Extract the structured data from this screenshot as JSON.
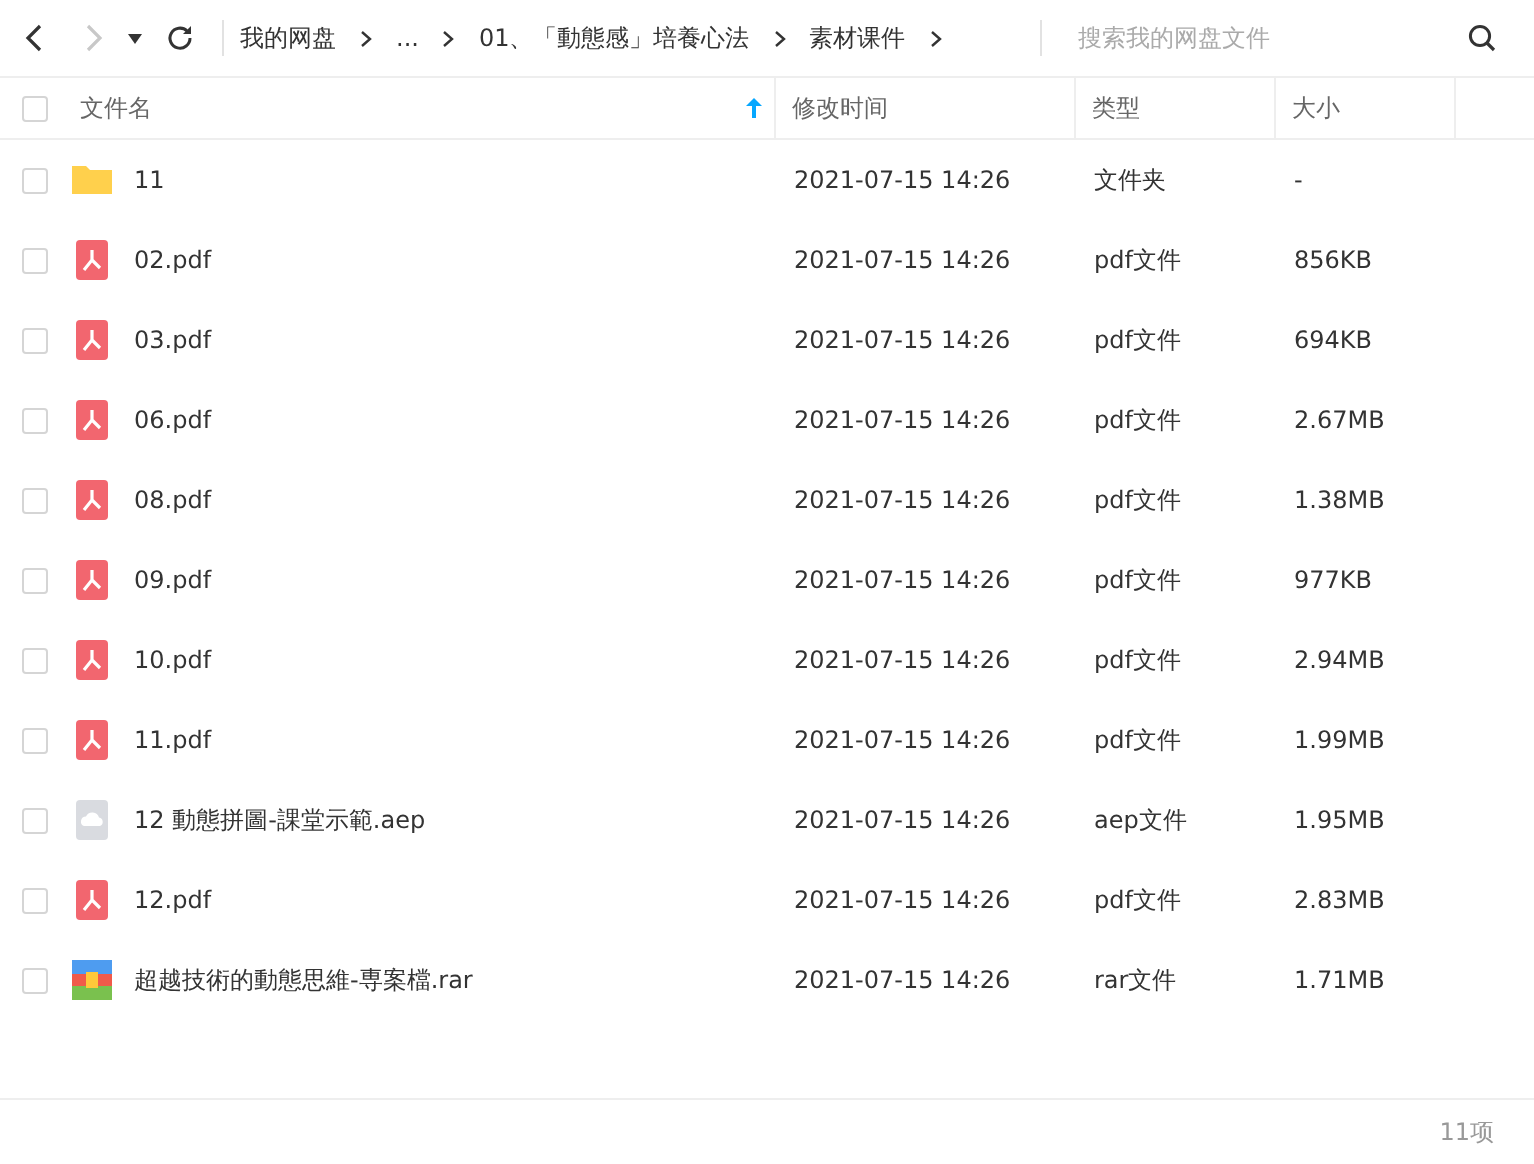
{
  "toolbar": {
    "back": {
      "disabled": false
    },
    "forward": {
      "disabled": true
    }
  },
  "breadcrumbs": [
    {
      "label": "我的网盘"
    },
    {
      "label": "..."
    },
    {
      "label": "01、「動態感」培養心法"
    },
    {
      "label": "素材课件"
    }
  ],
  "search": {
    "placeholder": "搜索我的网盘文件"
  },
  "table": {
    "select_all": {
      "checked": false
    },
    "columns": [
      {
        "label": "文件名",
        "sorted": true
      },
      {
        "label": "修改时间",
        "sorted": false
      },
      {
        "label": "类型",
        "sorted": false
      },
      {
        "label": "大小",
        "sorted": false
      }
    ],
    "rows": [
      {
        "kind": "folder",
        "name": "11",
        "modified": "2021-07-15 14:26",
        "type": "文件夹",
        "size": "-",
        "checked": false
      },
      {
        "kind": "pdf",
        "name": "02.pdf",
        "modified": "2021-07-15 14:26",
        "type": "pdf文件",
        "size": "856KB",
        "checked": false
      },
      {
        "kind": "pdf",
        "name": "03.pdf",
        "modified": "2021-07-15 14:26",
        "type": "pdf文件",
        "size": "694KB",
        "checked": false
      },
      {
        "kind": "pdf",
        "name": "06.pdf",
        "modified": "2021-07-15 14:26",
        "type": "pdf文件",
        "size": "2.67MB",
        "checked": false
      },
      {
        "kind": "pdf",
        "name": "08.pdf",
        "modified": "2021-07-15 14:26",
        "type": "pdf文件",
        "size": "1.38MB",
        "checked": false
      },
      {
        "kind": "pdf",
        "name": "09.pdf",
        "modified": "2021-07-15 14:26",
        "type": "pdf文件",
        "size": "977KB",
        "checked": false
      },
      {
        "kind": "pdf",
        "name": "10.pdf",
        "modified": "2021-07-15 14:26",
        "type": "pdf文件",
        "size": "2.94MB",
        "checked": false
      },
      {
        "kind": "pdf",
        "name": "11.pdf",
        "modified": "2021-07-15 14:26",
        "type": "pdf文件",
        "size": "1.99MB",
        "checked": false
      },
      {
        "kind": "cloud",
        "name": "12 動態拼圖-課堂示範.aep",
        "modified": "2021-07-15 14:26",
        "type": "aep文件",
        "size": "1.95MB",
        "checked": false
      },
      {
        "kind": "pdf",
        "name": "12.pdf",
        "modified": "2021-07-15 14:26",
        "type": "pdf文件",
        "size": "2.83MB",
        "checked": false
      },
      {
        "kind": "rar",
        "name": "超越技術的動態思維-専案檔.rar",
        "modified": "2021-07-15 14:26",
        "type": "rar文件",
        "size": "1.71MB",
        "checked": false
      }
    ]
  },
  "footer": {
    "count": "11项"
  }
}
